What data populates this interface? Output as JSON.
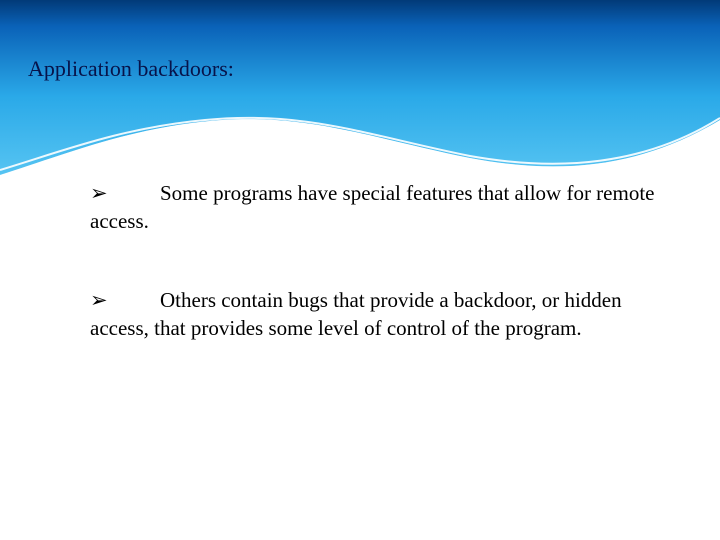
{
  "slide": {
    "title": "Application backdoors:",
    "bullets": [
      {
        "glyph": "➢",
        "text": "Some programs have special features that allow for remote access."
      },
      {
        "glyph": "➢",
        "text": "Others contain bugs that provide a backdoor, or hidden access, that provides some level of control of the program."
      }
    ]
  }
}
